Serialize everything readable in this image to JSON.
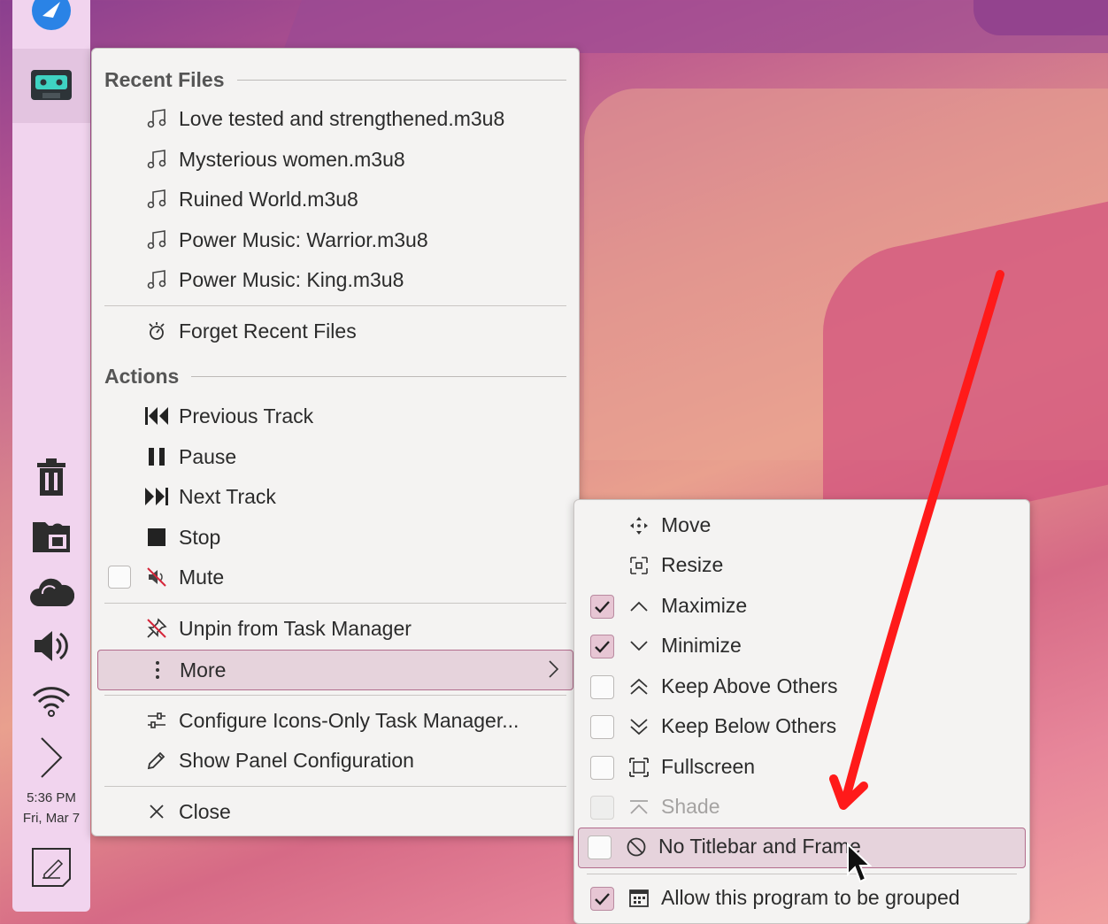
{
  "panel": {
    "clock_time": "5:36 PM",
    "clock_date": "Fri, Mar 7"
  },
  "menu": {
    "recent_header": "Recent Files",
    "recent_files": [
      "Love tested and strengthened.m3u8",
      "Mysterious women.m3u8",
      "Ruined World.m3u8",
      "Power Music: Warrior.m3u8",
      "Power Music: King.m3u8"
    ],
    "forget_label": "Forget Recent Files",
    "actions_header": "Actions",
    "previous_label": "Previous Track",
    "pause_label": "Pause",
    "next_label": "Next Track",
    "stop_label": "Stop",
    "mute_label": "Mute",
    "unpin_label": "Unpin from Task Manager",
    "more_label": "More",
    "configure_label": "Configure Icons-Only Task Manager...",
    "panel_config_label": "Show Panel Configuration",
    "close_label": "Close"
  },
  "submenu": {
    "move_label": "Move",
    "resize_label": "Resize",
    "maximize_label": "Maximize",
    "minimize_label": "Minimize",
    "keep_above_label": "Keep Above Others",
    "keep_below_label": "Keep Below Others",
    "fullscreen_label": "Fullscreen",
    "shade_label": "Shade",
    "no_titlebar_label": "No Titlebar and Frame",
    "grouped_label": "Allow this program to be grouped",
    "checked": {
      "maximize": true,
      "minimize": true,
      "keep_above": false,
      "keep_below": false,
      "fullscreen": false,
      "shade": false,
      "no_titlebar": false,
      "grouped": true
    }
  },
  "colors": {
    "annotation_arrow": "#ff1a1a",
    "highlight": "#e6d3dc",
    "panel": "#f1d4ee"
  }
}
